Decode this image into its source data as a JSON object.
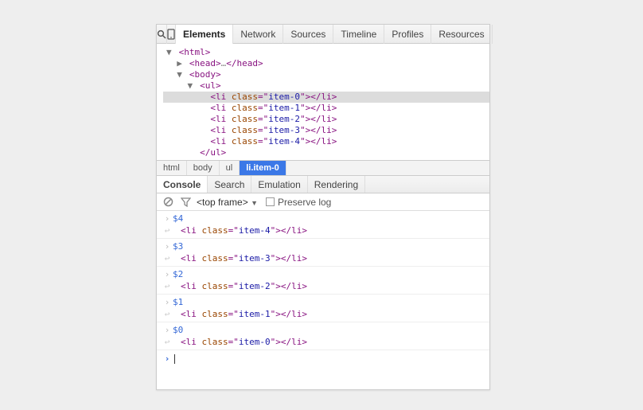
{
  "toolbar": {
    "tabs": [
      "Elements",
      "Network",
      "Sources",
      "Timeline",
      "Profiles",
      "Resources"
    ],
    "activeIndex": 0
  },
  "dom": {
    "rows": [
      {
        "indent": 0,
        "arrow": "down",
        "html": "<html>",
        "sel": false
      },
      {
        "indent": 1,
        "arrow": "right",
        "html": "<head>…</head>",
        "sel": false,
        "ellipsis": true
      },
      {
        "indent": 1,
        "arrow": "down",
        "html": "<body>",
        "sel": false
      },
      {
        "indent": 2,
        "arrow": "down",
        "html": "<ul>",
        "sel": false
      },
      {
        "indent": 3,
        "arrow": "",
        "html": "<li class=\"item-0\"></li>",
        "sel": true
      },
      {
        "indent": 3,
        "arrow": "",
        "html": "<li class=\"item-1\"></li>",
        "sel": false
      },
      {
        "indent": 3,
        "arrow": "",
        "html": "<li class=\"item-2\"></li>",
        "sel": false
      },
      {
        "indent": 3,
        "arrow": "",
        "html": "<li class=\"item-3\"></li>",
        "sel": false
      },
      {
        "indent": 3,
        "arrow": "",
        "html": "<li class=\"item-4\"></li>",
        "sel": false
      },
      {
        "indent": 2,
        "arrow": "",
        "html": "</ul>",
        "sel": false
      }
    ]
  },
  "breadcrumb": [
    "html",
    "body",
    "ul",
    "li.item-0"
  ],
  "breadcrumbSelected": 3,
  "drawer": {
    "tabs": [
      "Console",
      "Search",
      "Emulation",
      "Rendering"
    ],
    "activeIndex": 0,
    "frame": "<top frame>",
    "preserveLabel": "Preserve log"
  },
  "console": {
    "entries": [
      {
        "in": "$4",
        "out": "<li class=\"item-4\"></li>"
      },
      {
        "in": "$3",
        "out": "<li class=\"item-3\"></li>"
      },
      {
        "in": "$2",
        "out": "<li class=\"item-2\"></li>"
      },
      {
        "in": "$1",
        "out": "<li class=\"item-1\"></li>"
      },
      {
        "in": "$0",
        "out": "<li class=\"item-0\"></li>"
      }
    ],
    "prompt": ""
  }
}
